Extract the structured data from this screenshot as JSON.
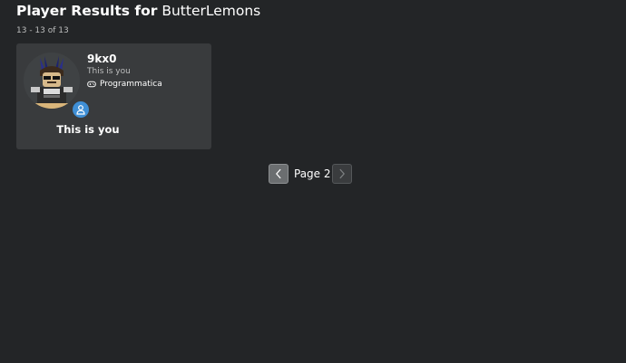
{
  "header": {
    "title_prefix": "Player Results for",
    "query": "ButterLemons",
    "result_count": "13 - 13 of 13"
  },
  "results": [
    {
      "username": "9kx0",
      "subtitle": "This is you",
      "game": "Programmatica",
      "game_icon": "controller-icon",
      "action_label": "This is you",
      "badge_icon": "user-icon",
      "badge_color": "#3f8fd6"
    }
  ],
  "pagination": {
    "label": "Page 2",
    "prev_icon": "chevron-left-icon",
    "next_icon": "chevron-right-icon"
  },
  "colors": {
    "background": "#232527",
    "card": "#393b3d",
    "secondary_text": "#bdbebe",
    "accent": "#3f8fd6"
  }
}
